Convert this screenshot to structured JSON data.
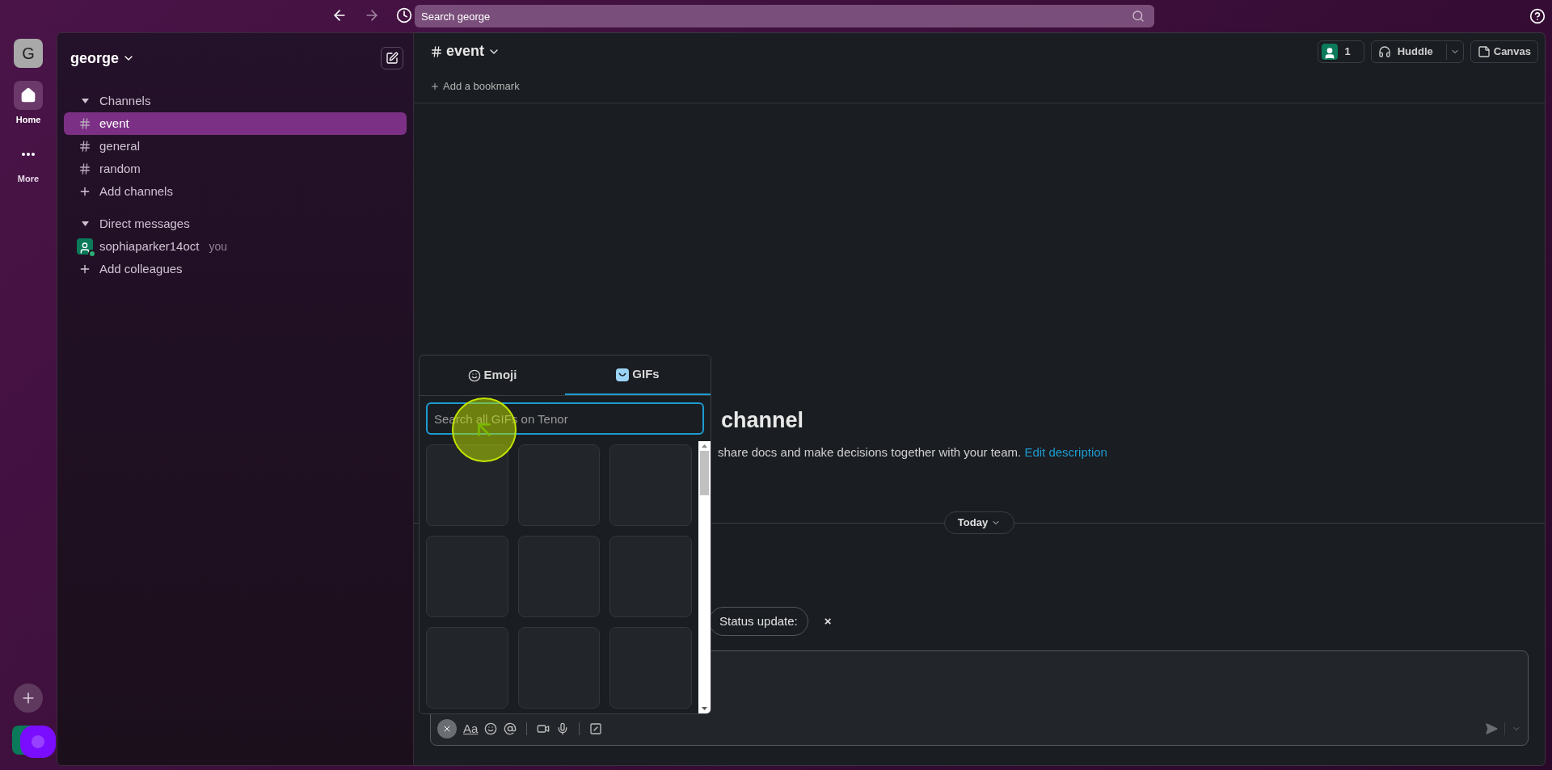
{
  "top_bar": {
    "search": {
      "placeholder": "Search george"
    }
  },
  "rail": {
    "workspace_initial": "G",
    "items": [
      {
        "kind": "home",
        "label": "Home",
        "selected": true
      },
      {
        "kind": "more",
        "label": "More",
        "selected": false
      }
    ]
  },
  "sidebar": {
    "workspace": "george",
    "sections": [
      {
        "title": "Channels",
        "expanded": true,
        "items": [
          {
            "kind": "channel",
            "label": "event",
            "selected": true
          },
          {
            "kind": "channel",
            "label": "general",
            "selected": false
          },
          {
            "kind": "channel",
            "label": "random",
            "selected": false
          },
          {
            "kind": "add",
            "label": "Add channels",
            "selected": false
          }
        ]
      },
      {
        "title": "Direct messages",
        "expanded": true,
        "items": [
          {
            "kind": "dm",
            "label": "sophiaparker14oct",
            "suffix": "you",
            "selected": false
          },
          {
            "kind": "add",
            "label": "Add colleagues",
            "selected": false
          }
        ]
      }
    ]
  },
  "header": {
    "channel": "event",
    "members": "1",
    "huddle": "Huddle",
    "canvas": "Canvas",
    "bookmark": "Add a bookmark"
  },
  "intro": {
    "title": "channel",
    "description": "share docs and make decisions together with your team.",
    "link": "Edit description"
  },
  "divider": {
    "label": "Today"
  },
  "status_chip": {
    "label": "Status update:",
    "dismiss": "×"
  },
  "picker": {
    "tabs": [
      {
        "kind": "emoji",
        "label": "Emoji",
        "selected": false
      },
      {
        "kind": "gif",
        "label": "GIFs",
        "selected": true
      }
    ],
    "search": {
      "placeholder": "Search all GIFs on Tenor"
    }
  },
  "composer": {
    "format_label": "Aa"
  }
}
